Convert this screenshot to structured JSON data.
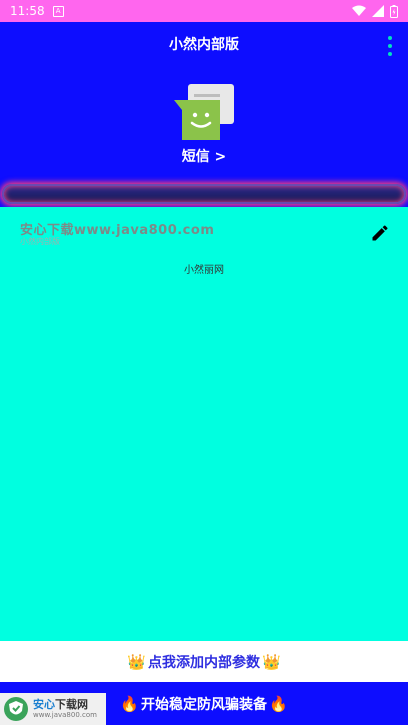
{
  "status_bar": {
    "time": "11:58",
    "notif_glyph": "A"
  },
  "header": {
    "title": "小然内部版",
    "sms_label": "短信 >"
  },
  "content": {
    "watermark": "安心下载www.java800.com",
    "watermark_sub": "小然内部版",
    "site_text": "小然丽网"
  },
  "buttons": {
    "add_params": {
      "label": "点我添加内部参数",
      "emoji": "👑"
    },
    "start": {
      "label": "开始稳定防风骗装备",
      "emoji": "🔥"
    }
  },
  "badge": {
    "title_a": "安心",
    "title_b": "下载网",
    "url": "www.java800.com"
  },
  "colors": {
    "header_bg": "#0d0dff",
    "content_bg": "#00ffe0",
    "status_bg": "#ff66ee",
    "accent": "#00e0c0"
  }
}
